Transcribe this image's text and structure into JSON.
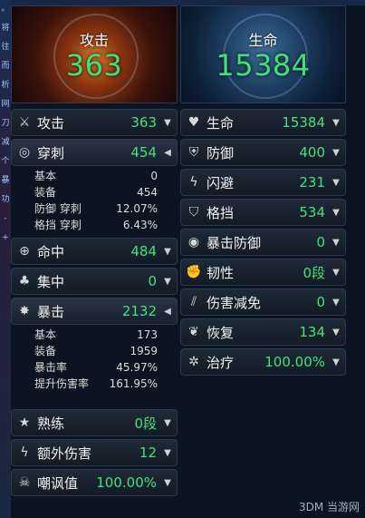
{
  "attack": {
    "label": "攻击",
    "value": "363"
  },
  "health": {
    "label": "生命",
    "value": "15384"
  },
  "left": {
    "attack_row": {
      "label": "攻击",
      "value": "363"
    },
    "pierce": {
      "label": "穿刺",
      "value": "454",
      "sub": [
        {
          "k": "基本",
          "v": "0"
        },
        {
          "k": "装备",
          "v": "454"
        },
        {
          "k": "防御 穿刺",
          "v": "12.07%"
        },
        {
          "k": "格挡 穿刺",
          "v": "6.43%"
        }
      ]
    },
    "accuracy": {
      "label": "命中",
      "value": "484"
    },
    "focus": {
      "label": "集中",
      "value": "0"
    },
    "crit": {
      "label": "暴击",
      "value": "2132",
      "sub": [
        {
          "k": "基本",
          "v": "173"
        },
        {
          "k": "装备",
          "v": "1959"
        },
        {
          "k": "暴击率",
          "v": "45.97%"
        },
        {
          "k": "提升伤害率",
          "v": "161.95%"
        }
      ]
    },
    "mastery": {
      "label": "熟练",
      "value": "0段"
    },
    "extra_damage": {
      "label": "额外伤害",
      "value": "12"
    },
    "taunt": {
      "label": "嘲讽值",
      "value": "100.00%"
    }
  },
  "right": {
    "hp_row": {
      "label": "生命",
      "value": "15384"
    },
    "defense": {
      "label": "防御",
      "value": "400"
    },
    "evade": {
      "label": "闪避",
      "value": "231"
    },
    "block": {
      "label": "格挡",
      "value": "534"
    },
    "crit_def": {
      "label": "暴击防御",
      "value": "0"
    },
    "toughness": {
      "label": "韧性",
      "value": "0段"
    },
    "dmg_reduce": {
      "label": "伤害减免",
      "value": "0"
    },
    "recovery": {
      "label": "恢复",
      "value": "134"
    },
    "heal": {
      "label": "治疗",
      "value": "100.00%"
    }
  },
  "sidebar_chars": [
    "。",
    "将",
    "往",
    "而",
    "析",
    "网",
    "刀",
    "减",
    "个",
    "暴",
    "功",
    "-",
    "+"
  ],
  "watermark": "3DM 当游网",
  "colors": {
    "value_green": "#46e07e",
    "big_green": "#42e07a"
  }
}
